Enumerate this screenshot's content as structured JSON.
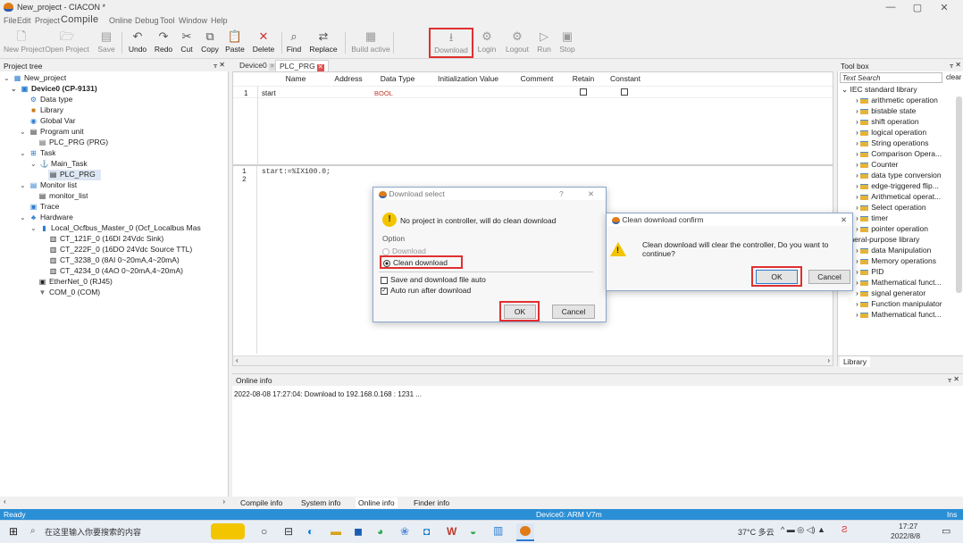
{
  "app": {
    "title": "New_project - CIACON *"
  },
  "menu": [
    "File",
    "Edit",
    "Project",
    "Compile",
    "Online",
    "Debug",
    "Tool",
    "Window",
    "Help"
  ],
  "toolbar": [
    "New Project",
    "Open Project",
    "Save",
    "Undo",
    "Redo",
    "Cut",
    "Copy",
    "Paste",
    "Delete",
    "Find",
    "Replace",
    "Build active",
    "Download",
    "Login",
    "Logout",
    "Run",
    "Stop"
  ],
  "project_tree": {
    "title": "Project tree",
    "items": [
      "New_project",
      "Device0 (CP-9131)",
      "Data type",
      "Library",
      "Global Var",
      "Program unit",
      "PLC_PRG (PRG)",
      "Task",
      "Main_Task",
      "PLC_PRG",
      "Monitor list",
      "monitor_list",
      "Trace",
      "Hardware",
      "Local_Ocfbus_Master_0 (Ocf_Localbus Mas",
      "CT_121F_0 (16DI 24Vdc Sink)",
      "CT_222F_0 (16DO 24Vdc Source TTL)",
      "CT_3238_0 (8AI 0~20mA,4~20mA)",
      "CT_4234_0 (4AO 0~20mA,4~20mA)",
      "EtherNet_0 (RJ45)",
      "COM_0 (COM)"
    ]
  },
  "editor_tabs": [
    "Device0",
    "PLC_PRG"
  ],
  "var_table": {
    "headers": [
      "Name",
      "Address",
      "Data Type",
      "Initialization Value",
      "Comment",
      "Retain",
      "Constant"
    ],
    "rows": [
      {
        "no": "1",
        "name": "start",
        "type": "BOOL"
      }
    ]
  },
  "code": {
    "lines": [
      "1",
      "2"
    ],
    "text": "start:=%IX100.0;"
  },
  "toolbox": {
    "title": "Tool box",
    "search_placeholder": "Text Search",
    "clear": "clear",
    "root": "IEC standard library",
    "items": [
      "arithmetic operation",
      "bistable state",
      "shift operation",
      "logical operation",
      "String operations",
      "Comparison Opera...",
      "Counter",
      "data type conversion",
      "edge-triggered flip...",
      "Arithmetical operat...",
      "Select operation",
      "timer",
      "pointer operation"
    ],
    "root2": "general-purpose library",
    "items2": [
      "data Manipulation",
      "Memory operations",
      "PID",
      "Mathematical funct...",
      "signal generator",
      "Function manipulator",
      "Mathematical funct..."
    ],
    "tab": "Library"
  },
  "online_info": {
    "title": "Online info",
    "line": "2022-08-08 17:27:04: Download to 192.168.0.168 : 1231 ..."
  },
  "bottom_tabs": [
    "Compile info",
    "System info",
    "Online info",
    "Finder info"
  ],
  "status": {
    "left": "Ready",
    "center": "Device0: ARM V7m",
    "right": "Ins"
  },
  "dialog1": {
    "title": "Download select",
    "message": "No project in controller, will do clean download",
    "option_label": "Option",
    "opt_download": "Download",
    "opt_clean": "Clean download",
    "chk_save": "Save and download file auto",
    "chk_autorun": "Auto run after download",
    "ok": "OK",
    "cancel": "Cancel"
  },
  "dialog2": {
    "title": "Clean download confirm",
    "message": "Clean download will clear the controller, Do you want to continue?",
    "ok": "OK",
    "cancel": "Cancel"
  },
  "taskbar": {
    "search": "在这里输入你要搜索的内容",
    "weather": "37°C 多云",
    "time": "17:27",
    "date": "2022/8/8"
  },
  "colors": {
    "accent": "#2b8fd6",
    "highlight": "#e03030"
  }
}
